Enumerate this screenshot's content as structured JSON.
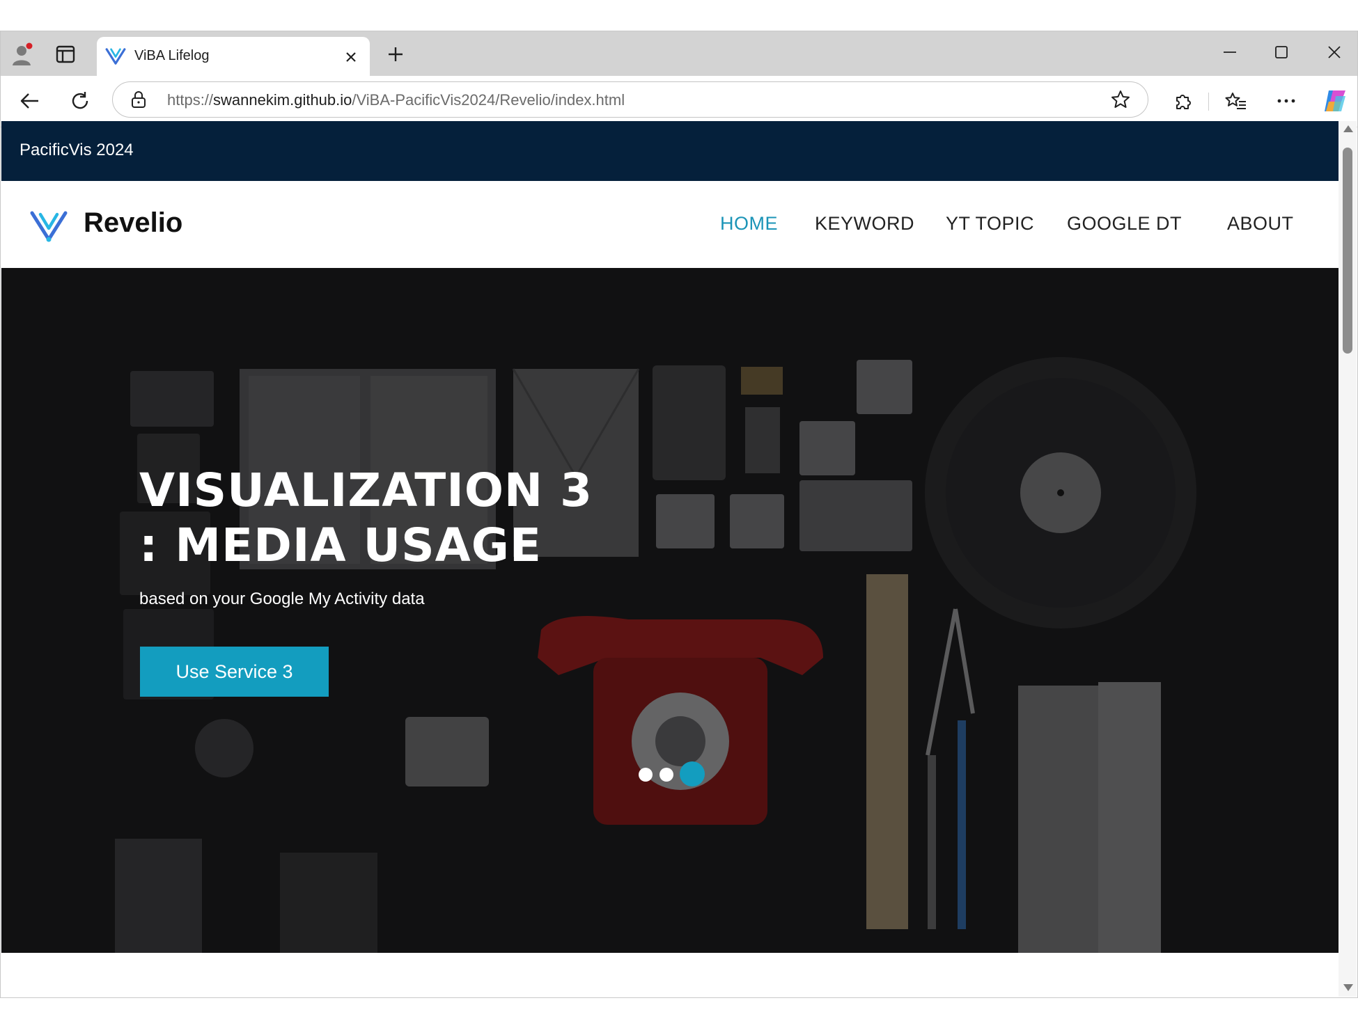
{
  "browser": {
    "tab_title": "ViBA Lifelog",
    "url_scheme": "https://",
    "url_host": "swannekim.github.io",
    "url_path": "/ViBA-PacificVis2024/Revelio/index.html",
    "icons": {
      "profile": "profile-icon",
      "tab_actions": "tab-actions-icon",
      "close_tab": "close-icon",
      "new_tab": "plus-icon",
      "back": "back-arrow-icon",
      "reload": "reload-icon",
      "site_info": "lock-icon",
      "favorite": "star-icon",
      "extensions": "puzzle-icon",
      "favorites": "favorites-icon",
      "more": "more-icon",
      "copilot": "copilot-icon"
    }
  },
  "page": {
    "topbar_text": "PacificVis 2024",
    "brand_name": "Revelio",
    "nav": [
      {
        "label": "HOME",
        "active": true
      },
      {
        "label": "KEYWORD",
        "active": false
      },
      {
        "label": "YT TOPIC",
        "active": false
      },
      {
        "label": "GOOGLE DT",
        "active": false
      },
      {
        "label": "ABOUT",
        "active": false
      }
    ],
    "hero": {
      "title_line1": "VISUALIZATION 3",
      "title_line2": ": MEDIA USAGE",
      "subtitle": "based on your Google My Activity data",
      "cta_label": "Use Service 3",
      "slide_count": 3,
      "active_slide": 3
    },
    "colors": {
      "topbar_bg": "#05203b",
      "accent": "#139dbf",
      "nav_active": "#1b94b7",
      "hero_bg": "#1b1b1d"
    }
  }
}
